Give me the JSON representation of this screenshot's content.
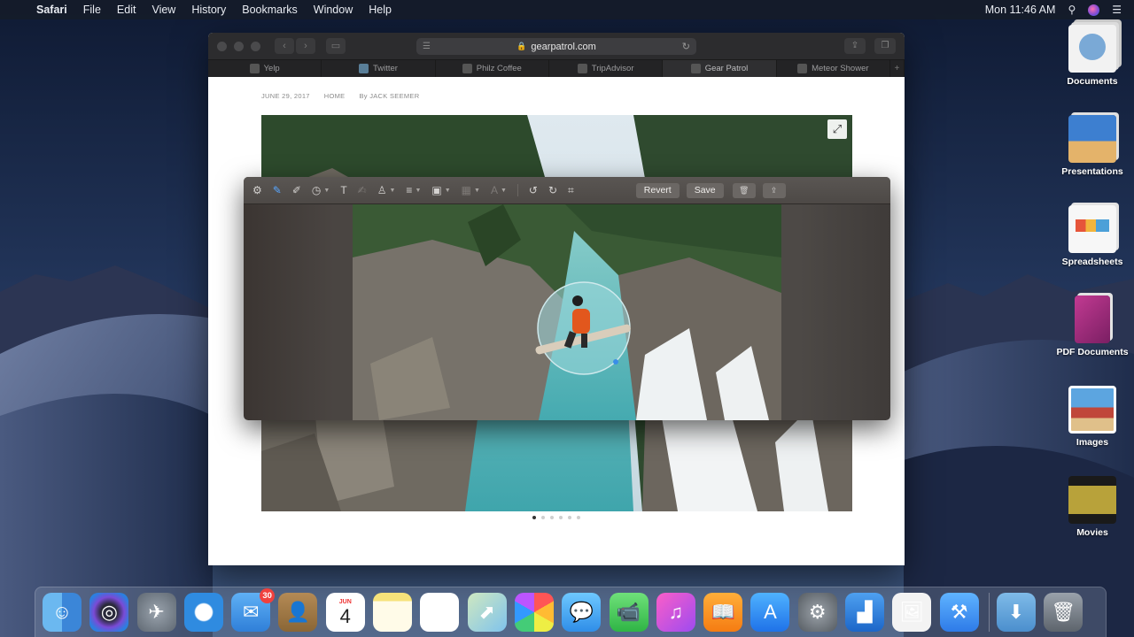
{
  "menubar": {
    "app_name": "Safari",
    "menus": [
      "File",
      "Edit",
      "View",
      "History",
      "Bookmarks",
      "Window",
      "Help"
    ],
    "clock": "Mon 11:46 AM"
  },
  "desktop": {
    "stacks": [
      {
        "label": "Documents",
        "icon": "documents-stack-icon"
      },
      {
        "label": "Presentations",
        "icon": "presentations-stack-icon"
      },
      {
        "label": "Spreadsheets",
        "icon": "spreadsheets-stack-icon"
      },
      {
        "label": "PDF Documents",
        "icon": "pdf-stack-icon"
      },
      {
        "label": "Images",
        "icon": "images-stack-icon"
      },
      {
        "label": "Movies",
        "icon": "movies-stack-icon"
      }
    ]
  },
  "safari": {
    "url": "gearpatrol.com",
    "favorites": [
      {
        "label": "Yelp"
      },
      {
        "label": "Twitter"
      },
      {
        "label": "Philz Coffee"
      },
      {
        "label": "TripAdvisor"
      },
      {
        "label": "Gear Patrol"
      },
      {
        "label": "Meteor Shower"
      }
    ],
    "article": {
      "date": "JUNE 29, 2017",
      "section": "HOME",
      "author": "By JACK SEEMER"
    },
    "carousel": {
      "slides": 6,
      "current": 1
    }
  },
  "markup": {
    "revert_label": "Revert",
    "save_label": "Save"
  },
  "dock": {
    "apps": [
      {
        "name": "Finder",
        "icon": "finder-icon"
      },
      {
        "name": "Siri",
        "icon": "siri-icon"
      },
      {
        "name": "Launchpad",
        "icon": "launchpad-icon"
      },
      {
        "name": "Safari",
        "icon": "safari-icon"
      },
      {
        "name": "Mail",
        "icon": "mail-icon",
        "badge": "30"
      },
      {
        "name": "Contacts",
        "icon": "contacts-icon"
      },
      {
        "name": "Calendar",
        "icon": "calendar-icon",
        "month": "JUN",
        "day": "4"
      },
      {
        "name": "Notes",
        "icon": "notes-icon"
      },
      {
        "name": "Reminders",
        "icon": "reminders-icon"
      },
      {
        "name": "Maps",
        "icon": "maps-icon"
      },
      {
        "name": "Photos",
        "icon": "photos-icon"
      },
      {
        "name": "Messages",
        "icon": "messages-icon"
      },
      {
        "name": "FaceTime",
        "icon": "facetime-icon"
      },
      {
        "name": "iTunes",
        "icon": "itunes-icon"
      },
      {
        "name": "Books",
        "icon": "books-icon"
      },
      {
        "name": "App Store",
        "icon": "app-store-icon"
      },
      {
        "name": "System Preferences",
        "icon": "system-preferences-icon"
      },
      {
        "name": "Keynote",
        "icon": "keynote-icon"
      },
      {
        "name": "Preview",
        "icon": "preview-icon"
      },
      {
        "name": "Xcode",
        "icon": "xcode-icon"
      },
      {
        "name": "Downloads",
        "icon": "downloads-folder-icon"
      },
      {
        "name": "Trash",
        "icon": "trash-icon"
      }
    ]
  }
}
